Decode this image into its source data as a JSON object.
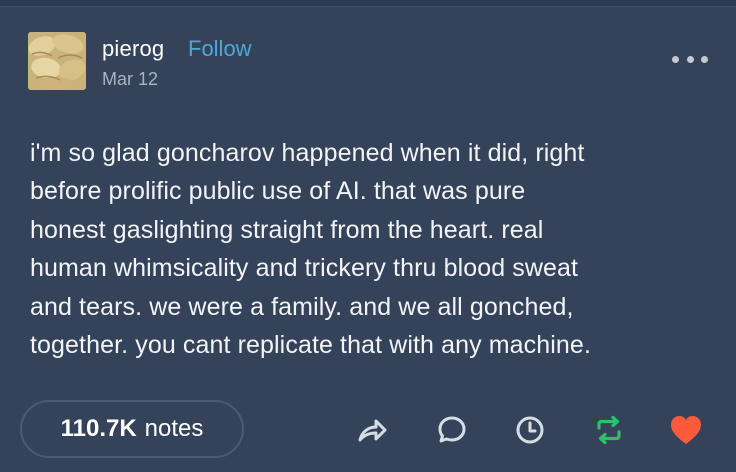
{
  "post": {
    "author": "pierog",
    "follow_label": "Follow",
    "date": "Mar 12",
    "body_lines": [
      "i'm so glad goncharov happened when it did, right",
      "before prolific public use of AI. that was pure",
      "honest gaslighting straight from the heart. real",
      "human whimsicality and trickery thru blood sweat",
      "and tears. we were a family. and we all gonched,",
      "together. you cant replicate that with any machine."
    ]
  },
  "footer": {
    "notes_count": "110.7K",
    "notes_label": "notes",
    "actions": [
      "share-icon",
      "reply-icon",
      "clock-icon",
      "reblog-icon",
      "heart-icon"
    ]
  },
  "colors": {
    "background": "#34435a",
    "follow_link": "#4fa7d8",
    "reblog": "#2fbf6b",
    "like": "#ff5a3c"
  }
}
